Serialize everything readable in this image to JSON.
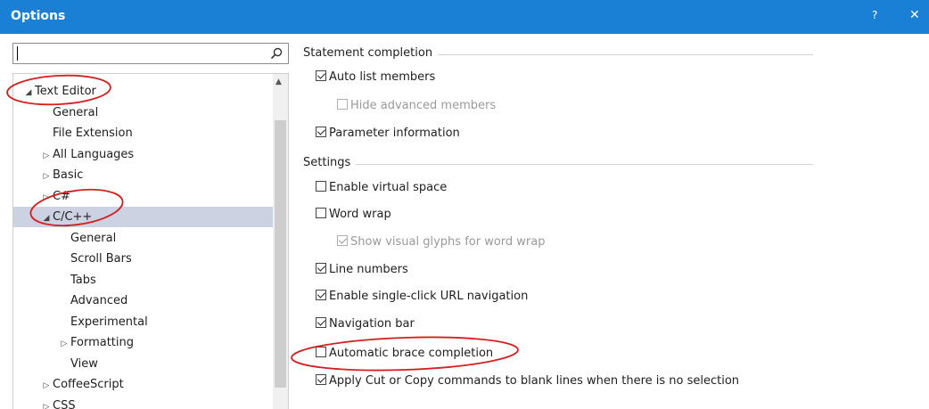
{
  "window": {
    "title": "Options",
    "help_label": "?",
    "close_label": "✕"
  },
  "search": {
    "value": "",
    "placeholder": ""
  },
  "tree": [
    {
      "label": "Text Editor",
      "arrow": "◢",
      "indent": 1,
      "selected": false
    },
    {
      "label": "General",
      "arrow": "",
      "indent": 2,
      "selected": false
    },
    {
      "label": "File Extension",
      "arrow": "",
      "indent": 2,
      "selected": false
    },
    {
      "label": "All Languages",
      "arrow": "▷",
      "indent": 2,
      "selected": false
    },
    {
      "label": "Basic",
      "arrow": "▷",
      "indent": 2,
      "selected": false
    },
    {
      "label": "C#",
      "arrow": "▷",
      "indent": 2,
      "selected": false
    },
    {
      "label": "C/C++",
      "arrow": "◢",
      "indent": 2,
      "selected": true
    },
    {
      "label": "General",
      "arrow": "",
      "indent": 3,
      "selected": false
    },
    {
      "label": "Scroll Bars",
      "arrow": "",
      "indent": 3,
      "selected": false
    },
    {
      "label": "Tabs",
      "arrow": "",
      "indent": 3,
      "selected": false
    },
    {
      "label": "Advanced",
      "arrow": "",
      "indent": 3,
      "selected": false
    },
    {
      "label": "Experimental",
      "arrow": "",
      "indent": 3,
      "selected": false
    },
    {
      "label": "Formatting",
      "arrow": "▷",
      "indent": 3,
      "selected": false
    },
    {
      "label": "View",
      "arrow": "",
      "indent": 3,
      "selected": false
    },
    {
      "label": "CoffeeScript",
      "arrow": "▷",
      "indent": 2,
      "selected": false
    },
    {
      "label": "CSS",
      "arrow": "▷",
      "indent": 2,
      "selected": false
    }
  ],
  "groups": {
    "statement_completion": "Statement completion",
    "settings": "Settings"
  },
  "options": {
    "auto_list_members": {
      "label": "Auto list members",
      "checked": true,
      "disabled": false
    },
    "hide_advanced_members": {
      "label": "Hide advanced members",
      "checked": false,
      "disabled": true
    },
    "parameter_information": {
      "label": "Parameter information",
      "checked": true,
      "disabled": false
    },
    "enable_virtual_space": {
      "label": "Enable virtual space",
      "checked": false,
      "disabled": false
    },
    "word_wrap": {
      "label": "Word wrap",
      "checked": false,
      "disabled": false
    },
    "show_visual_glyphs": {
      "label": "Show visual glyphs for word wrap",
      "checked": true,
      "disabled": true
    },
    "line_numbers": {
      "label": "Line numbers",
      "checked": true,
      "disabled": false
    },
    "single_click_url": {
      "label": "Enable single-click URL navigation",
      "checked": true,
      "disabled": false
    },
    "navigation_bar": {
      "label": "Navigation bar",
      "checked": true,
      "disabled": false
    },
    "automatic_brace_completion": {
      "label": "Automatic brace completion",
      "checked": false,
      "disabled": false
    },
    "apply_cut_copy": {
      "label": "Apply Cut or Copy commands to blank lines when there is no selection",
      "checked": true,
      "disabled": false
    }
  },
  "colors": {
    "titlebar": "#1a80d6",
    "selection": "#cdd2e3",
    "annotation": "#d42020"
  },
  "icons": {
    "search": "search-icon",
    "help": "help-icon",
    "close": "close-icon"
  }
}
